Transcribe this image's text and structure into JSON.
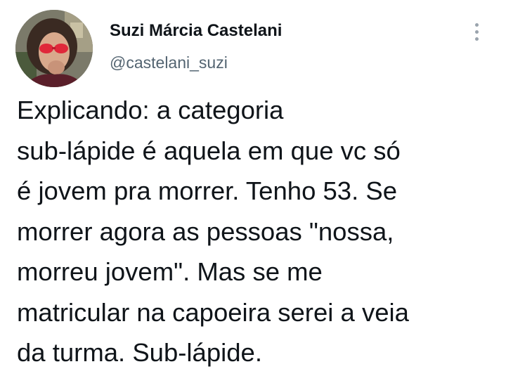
{
  "author": {
    "name": "Suzi Márcia Castelani",
    "handle": "@castelani_suzi",
    "avatar_icon": "profile-photo-woman-red-glasses"
  },
  "menu_icon": "more-vertical-icon",
  "tweet": {
    "lines": [
      "Explicando: a categoria",
      "sub-lápide é aquela em que vc só",
      "é jovem pra morrer. Tenho 53. Se",
      "morrer agora as pessoas \"nossa,",
      "morreu jovem\". Mas se me",
      "matricular na capoeira serei a veia",
      "da turma. Sub-lápide."
    ]
  },
  "colors": {
    "text": "#0f1419",
    "secondary": "#536471",
    "background": "#ffffff"
  }
}
